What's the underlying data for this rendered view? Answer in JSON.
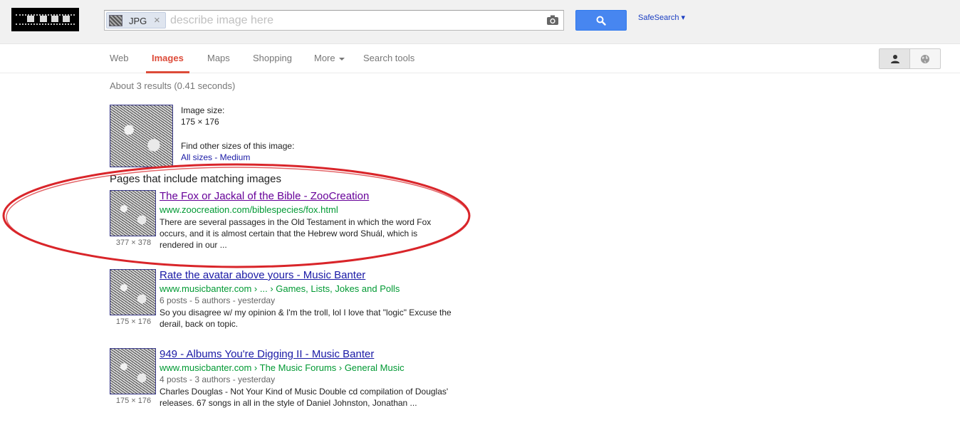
{
  "search": {
    "chip_label": "JPG",
    "chip_close": "×",
    "placeholder": "describe image here",
    "safesearch": "SafeSearch ▾"
  },
  "nav": {
    "tabs": [
      "Web",
      "Images",
      "Maps",
      "Shopping",
      "More",
      "Search tools"
    ],
    "active_tab": "Images"
  },
  "stats": "About 3 results (0.41 seconds)",
  "image_info": {
    "size_label": "Image size:",
    "size_value": "175 × 176",
    "other_sizes_label": "Find other sizes of this image:",
    "other_sizes_links": "All sizes - Medium"
  },
  "pages_heading": "Pages that include matching images",
  "results": [
    {
      "title": "The Fox or Jackal of the Bible - ZooCreation",
      "url": "www.zoocreation.com/biblespecies/fox.html",
      "meta": "",
      "snippet_lines": [
        "There are several passages in the Old Testament in which the word Fox",
        "occurs, and it is almost certain that the Hebrew word Shuál, which is",
        "rendered in our ..."
      ],
      "dims": "377 × 378",
      "visited": true
    },
    {
      "title": "Rate the avatar above yours - Music Banter",
      "url": "www.musicbanter.com › ... › Games, Lists, Jokes and Polls",
      "meta": "6 posts - 5 authors - yesterday",
      "snippet_lines": [
        "So you disagree w/ my opinion & I'm the troll, lol I love that \"logic\" Excuse the",
        "derail, back on topic."
      ],
      "dims": "175 × 176",
      "visited": false
    },
    {
      "title": "949 - Albums You're Digging II - Music Banter",
      "url": "www.musicbanter.com › The Music Forums › General Music",
      "meta": "4 posts - 3 authors - yesterday",
      "snippet_lines": [
        "Charles Douglas - Not Your Kind of Music Double cd compilation of Douglas'",
        "releases. 67 songs in all in the style of Daniel Johnston, Jonathan ..."
      ],
      "dims": "175 × 176",
      "visited": false
    }
  ],
  "colors": {
    "accent_red": "#dd4b39",
    "link_blue": "#1a1aa6",
    "url_green": "#009933",
    "annotation_red": "#d9252a",
    "search_button_blue": "#4786f0"
  },
  "icons": [
    "camera-icon",
    "search-icon",
    "user-icon",
    "globe-icon",
    "caret-down-icon"
  ]
}
